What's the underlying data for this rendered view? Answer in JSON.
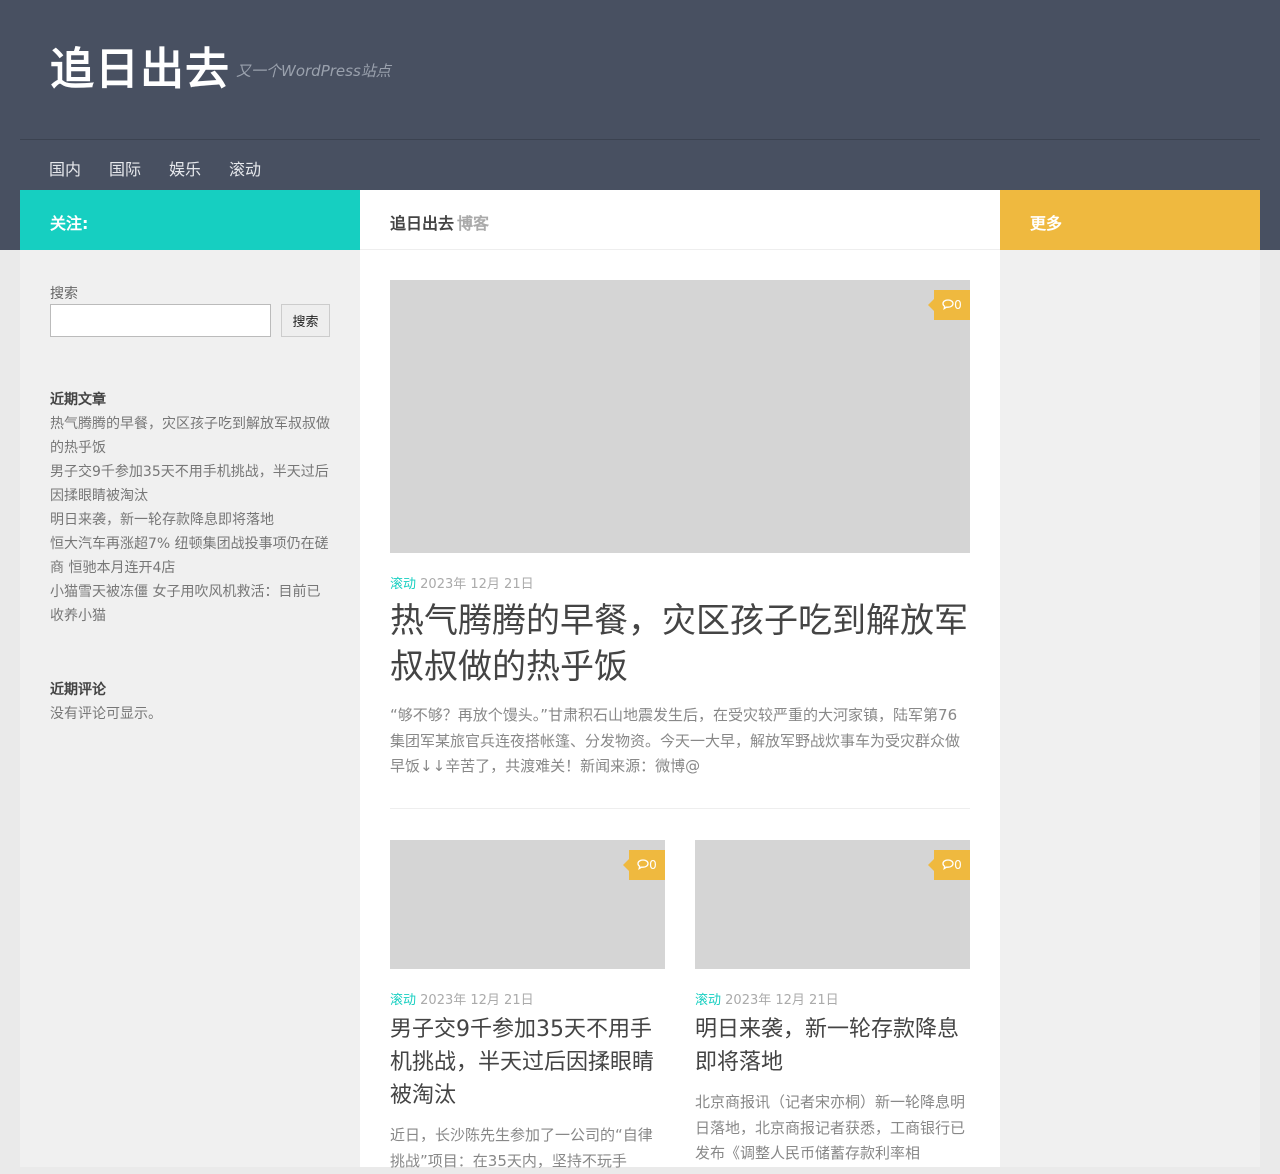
{
  "site": {
    "title": "追日出去",
    "description": "又一个WordPress站点"
  },
  "nav": {
    "items": [
      {
        "label": "国内"
      },
      {
        "label": "国际"
      },
      {
        "label": "娱乐"
      },
      {
        "label": "滚动"
      }
    ]
  },
  "left": {
    "follow_label": "关注:",
    "search": {
      "label": "搜索",
      "value": "",
      "placeholder": "",
      "button_label": "搜索"
    },
    "recent_posts": {
      "title": "近期文章",
      "items": [
        {
          "label": "热气腾腾的早餐，灾区孩子吃到解放军叔叔做的热乎饭"
        },
        {
          "label": "男子交9千参加35天不用手机挑战，半天过后因揉眼睛被淘汰"
        },
        {
          "label": "明日来袭，新一轮存款降息即将落地"
        },
        {
          "label": "恒大汽车再涨超7% 纽顿集团战投事项仍在磋商 恒驰本月连开4店"
        },
        {
          "label": "小猫雪天被冻僵 女子用吹风机救活：目前已收养小猫"
        }
      ]
    },
    "recent_comments": {
      "title": "近期评论",
      "empty_text": "没有评论可显示。"
    }
  },
  "main": {
    "heading": {
      "site": "追日出去",
      "suffix": "博客"
    },
    "featured": {
      "comment_count": "0",
      "category": "滚动",
      "date": "2023年 12月 21日",
      "title": "热气腾腾的早餐，灾区孩子吃到解放军叔叔做的热乎饭",
      "excerpt": "“够不够？再放个馒头。”甘肃积石山地震发生后，在受灾较严重的大河家镇，陆军第76集团军某旅官兵连夜搭帐篷、分发物资。今天一大早，解放军野战炊事车为受灾群众做早饭↓↓辛苦了，共渡难关！新闻来源：微博@"
    },
    "posts": [
      {
        "comment_count": "0",
        "category": "滚动",
        "date": "2023年 12月 21日",
        "title": "男子交9千参加35天不用手机挑战，半天过后因揉眼睛被淘汰",
        "excerpt": "近日，长沙陈先生参加了一公司的“自律挑战”项目：在35天内，坚持不玩手"
      },
      {
        "comment_count": "0",
        "category": "滚动",
        "date": "2023年 12月 21日",
        "title": "明日来袭，新一轮存款降息即将落地",
        "excerpt": "北京商报讯（记者宋亦桐）新一轮降息明日落地，北京商报记者获悉，工商银行已发布《调整人民币储蓄存款利率相"
      }
    ]
  },
  "right": {
    "more_label": "更多"
  },
  "colors": {
    "header_bg": "#485061",
    "teal": "#16cfc1",
    "yellow": "#efb93f"
  },
  "icons": {
    "comment": "comment-icon"
  }
}
